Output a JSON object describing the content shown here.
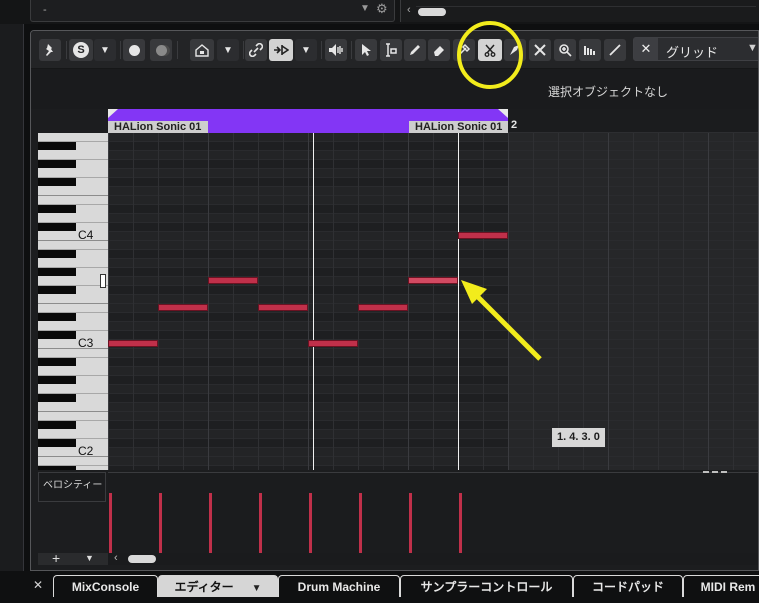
{
  "top": {
    "left_value": "-",
    "scroll_left_arrow": "‹"
  },
  "toolbar": {
    "solo_label": "S",
    "grid_label": "グリッド",
    "grid_icon": "snap-x-icon"
  },
  "infobar": {
    "no_selection": "選択オブジェクトなし"
  },
  "events": [
    {
      "name": "HALion Sonic 01"
    },
    {
      "name": "HALion Sonic 01"
    }
  ],
  "ruler": {
    "bar_2": "2"
  },
  "keyboard": {
    "labels": [
      "C4",
      "C3",
      "C2"
    ]
  },
  "tooltip": "1. 4. 3.  0",
  "velocity": {
    "label": "ベロシティー"
  },
  "bottom": {
    "plus": "+",
    "down": "▼",
    "scroll_left_arrow": "‹"
  },
  "tabs": {
    "close": "✕",
    "items": [
      {
        "label": "MixConsole"
      },
      {
        "label": "エディター",
        "dropdown": "▼"
      },
      {
        "label": "Drum Machine"
      },
      {
        "label": "サンプラーコントロール"
      },
      {
        "label": "コードパッド"
      },
      {
        "label": "MIDI Rem"
      }
    ]
  },
  "colors": {
    "event": "#8336f5",
    "note": "#c0304a",
    "highlight": "#f2ec1c"
  }
}
